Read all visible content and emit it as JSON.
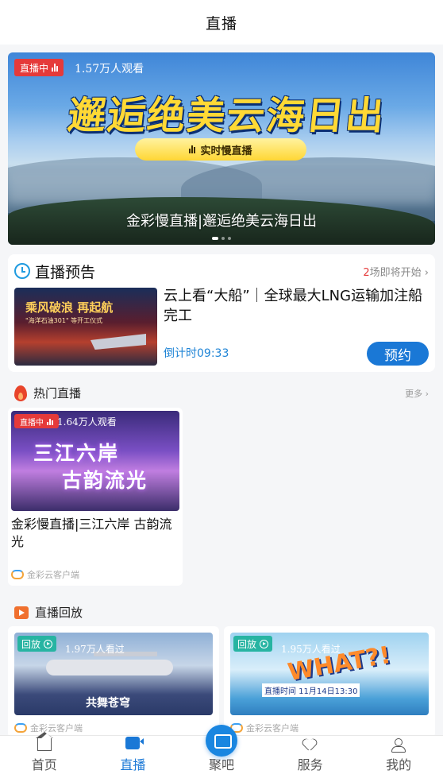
{
  "header": {
    "title": "直播"
  },
  "hero": {
    "live_label": "直播中",
    "viewers": "1.57万人观看",
    "headline": "邂逅绝美云海日出",
    "pill_label": "实时慢直播",
    "caption": "金彩慢直播|邂逅绝美云海日出"
  },
  "preview": {
    "section_title": "直播预告",
    "count_num": "2",
    "count_suffix": "场即将开始 ›",
    "thumb_text": "乘风破浪 再起航",
    "thumb_subtext": "\"海洋石油301\" 等开工仪式",
    "title": "云上看“大船”｜全球最大LNG运输加注船完工",
    "countdown": "倒计时09:33",
    "book_label": "预约"
  },
  "hot": {
    "section_title": "热门直播",
    "more": "更多 ›",
    "card": {
      "live_label": "直播中",
      "viewers": "1.64万人观看",
      "thumb_line1": "三江六岸",
      "thumb_line2": "古韵流光",
      "title": "金彩慢直播|三江六岸 古韵流光",
      "source": "金彩云客户端"
    }
  },
  "replay": {
    "section_title": "直播回放",
    "cards": [
      {
        "tag": "回放",
        "viewers": "1.97万人看过",
        "thumb_text": "共舞苍穹",
        "source": "金彩云客户端"
      },
      {
        "tag": "回放",
        "viewers": "1.95万人看过",
        "thumb_text": "WHAT?!",
        "thumb_subtext": "直播时间 11月14日13:30",
        "source": "金彩云客户端"
      }
    ]
  },
  "tabbar": {
    "items": [
      {
        "label": "首页",
        "icon": "home-icon"
      },
      {
        "label": "直播",
        "icon": "live-icon"
      },
      {
        "label": "聚吧",
        "icon": "chat-icon"
      },
      {
        "label": "服务",
        "icon": "heart-icon"
      },
      {
        "label": "我的",
        "icon": "user-icon"
      }
    ],
    "active": "直播"
  },
  "colors": {
    "accent": "#1a78d6",
    "live_red": "#e53a3a",
    "replay_teal": "#27b4a2"
  }
}
